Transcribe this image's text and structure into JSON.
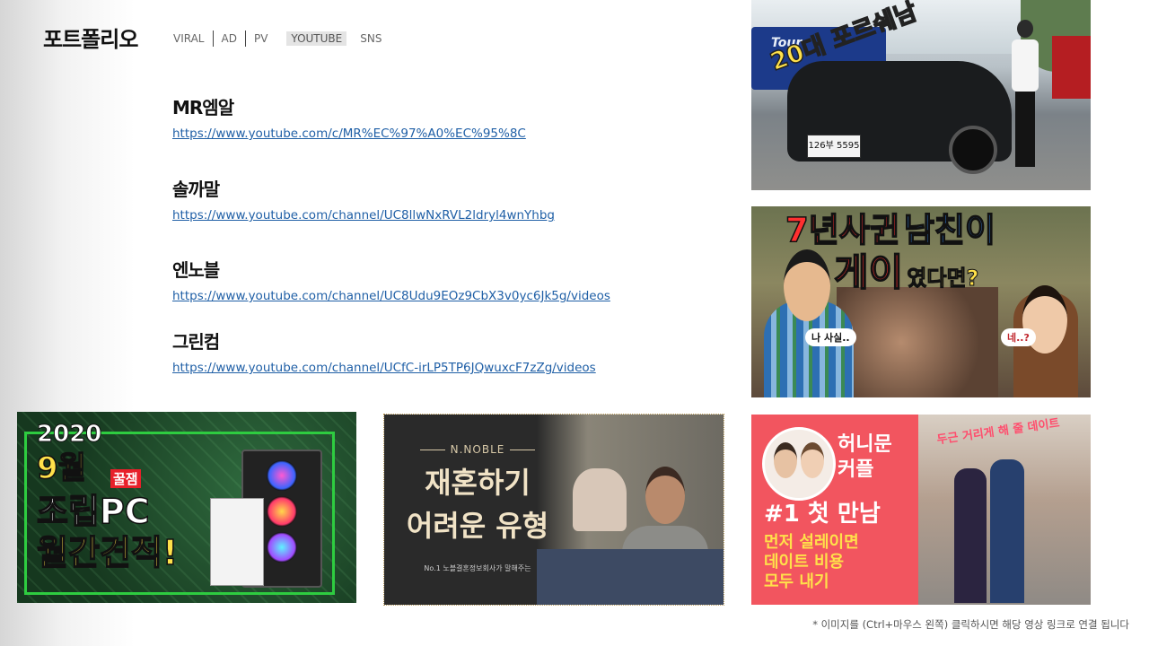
{
  "header": {
    "title": "포트폴리오",
    "tabs": [
      {
        "label": "VIRAL",
        "active": false
      },
      {
        "label": "AD",
        "active": false
      },
      {
        "label": "PV",
        "active": false
      },
      {
        "label": "YOUTUBE",
        "active": true
      },
      {
        "label": "SNS",
        "active": false
      }
    ]
  },
  "channels": [
    {
      "name": "MR엠알",
      "url": "https://www.youtube.com/c/MR%EC%97%A0%EC%95%8C"
    },
    {
      "name": "솔까말",
      "url": "https://www.youtube.com/channel/UC8llwNxRVL2ldryl4wnYhbg"
    },
    {
      "name": "엔노블",
      "url": "https://www.youtube.com/channel/UC8Udu9EOz9CbX3v0yc6Jk5g/videos"
    },
    {
      "name": "그린컴",
      "url": "https://www.youtube.com/channel/UCfC-irLP5TP6JQwuxcF7zZg/videos"
    }
  ],
  "thumbnails": {
    "porsche": {
      "caption": "20대 포르쉐남",
      "plate": "126부 5595",
      "bus": "Tour"
    },
    "couple7": {
      "caption_line1a": "7년사귄",
      "caption_line1b": "남친이",
      "caption_line2a": "게이",
      "caption_line2b": "였다면?",
      "bubble_left": "나 사실..",
      "bubble_right": "네..?"
    },
    "pc": {
      "year": "2020",
      "month": "9월",
      "badge": "꿀잼",
      "line1": "조립PC",
      "line2": "월간견적!"
    },
    "noble": {
      "brand": "N.NOBLE",
      "line1": "재혼하기",
      "line2": "어려운 유형",
      "sub": "No.1 노블결혼정보회사가 말해주는"
    },
    "honey": {
      "name1": "허니문",
      "name2": "커플",
      "line1": "#1 첫 만남",
      "line2": "먼저 설레이면",
      "line3": "데이트 비용",
      "line4": "모두 내기",
      "sign": "두근 거리게 해 줄 데이트"
    }
  },
  "footer": {
    "note": "* 이미지를 (Ctrl+마우스 왼쪽) 클릭하시면 해당 영상 링크로 연결 됩니다"
  },
  "colors": {
    "link": "#1f5fa6",
    "yellow": "#ffe14a",
    "red": "#e8202a",
    "pink": "#f2555f",
    "green": "#2ecc40"
  }
}
